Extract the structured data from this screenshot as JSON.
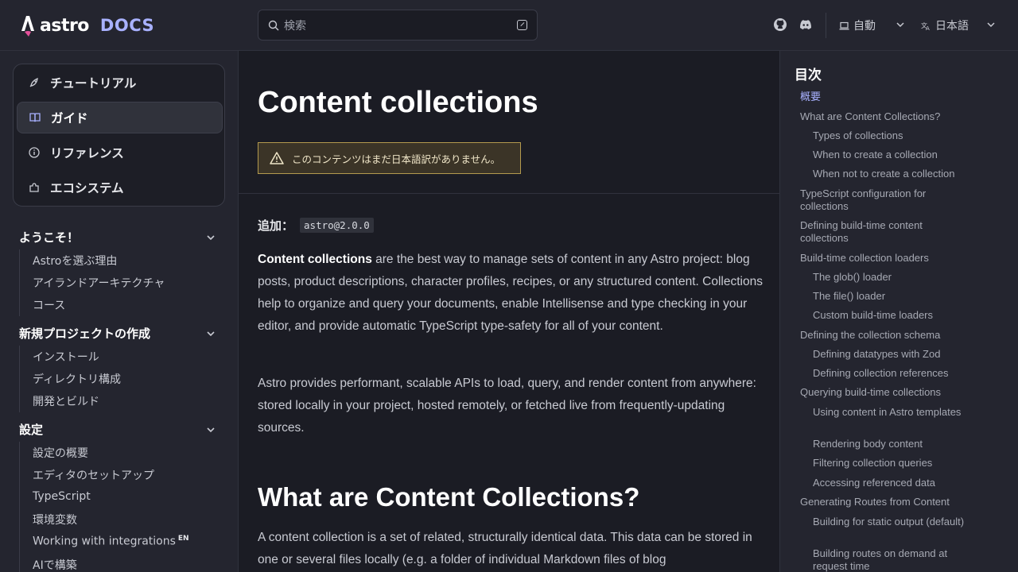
{
  "header": {
    "logo_word": "astro",
    "logo_docs": "DOCS",
    "search_placeholder": "検索",
    "theme_select": "自動",
    "language_select": "日本語"
  },
  "sidebar": {
    "top_nav": [
      {
        "label": "チュートリアル",
        "icon": "rocket-icon"
      },
      {
        "label": "ガイド",
        "icon": "book-icon",
        "active": true
      },
      {
        "label": "リファレンス",
        "icon": "info-icon"
      },
      {
        "label": "エコシステム",
        "icon": "puzzle-icon"
      }
    ],
    "groups": [
      {
        "title": "ようこそ！",
        "items": [
          "Astroを選ぶ理由",
          "アイランドアーキテクチャ",
          "コース"
        ]
      },
      {
        "title": "新規プロジェクトの作成",
        "items": [
          "インストール",
          "ディレクトリ構成",
          "開発とビルド"
        ]
      },
      {
        "title": "設定",
        "items": [
          "設定の概要",
          "エディタのセットアップ",
          "TypeScript",
          "環境変数",
          "Working with integrations",
          "AIで構築"
        ]
      }
    ],
    "en_tag": "EN"
  },
  "main": {
    "title": "Content collections",
    "caution": "このコンテンツはまだ日本語訳がありません。",
    "added_label": "追加：",
    "added_version": "astro@2.0.0",
    "intro_bold": "Content collections",
    "intro_rest": " are the best way to manage sets of content in any Astro project: blog posts, product descriptions, character profiles, recipes, or any structured content. Collections help to organize and query your documents, enable Intellisense and type checking in your editor, and provide automatic TypeScript type-safety for all of your content.",
    "para2": "Astro provides performant, scalable APIs to load, query, and render content from anywhere: stored locally in your project, hosted remotely, or fetched live from frequently-updating sources.",
    "h2": "What are Content Collections?",
    "para3": "A content collection is a set of related, structurally identical data. This data can be stored in one or several files locally (e.g. a folder of individual Markdown files of blog"
  },
  "toc": {
    "title": "目次",
    "items": [
      {
        "label": "概要",
        "level": 1,
        "current": true
      },
      {
        "label": "What are Content Collections?",
        "level": 1
      },
      {
        "label": "Types of collections",
        "level": 2
      },
      {
        "label": "When to create a collection",
        "level": 2
      },
      {
        "label": "When not to create a collection",
        "level": 2
      },
      {
        "label": "TypeScript configuration for collections",
        "level": 1
      },
      {
        "label": "Defining build-time content collections",
        "level": 1
      },
      {
        "label": "Build-time collection loaders",
        "level": 1
      },
      {
        "label": "The glob() loader",
        "level": 2
      },
      {
        "label": "The file() loader",
        "level": 2
      },
      {
        "label": "Custom build-time loaders",
        "level": 2
      },
      {
        "label": "Defining the collection schema",
        "level": 1
      },
      {
        "label": "Defining datatypes with Zod",
        "level": 2
      },
      {
        "label": "Defining collection references",
        "level": 2
      },
      {
        "label": "Querying build-time collections",
        "level": 1
      },
      {
        "label": "Using content in Astro templates",
        "level": 2
      },
      {
        "label": "Rendering body content",
        "level": 2
      },
      {
        "label": "Filtering collection queries",
        "level": 2
      },
      {
        "label": "Accessing referenced data",
        "level": 2
      },
      {
        "label": "Generating Routes from Content",
        "level": 1
      },
      {
        "label": "Building for static output (default)",
        "level": 2
      },
      {
        "label": "Building routes on demand at request time",
        "level": 2
      }
    ]
  },
  "colors": {
    "accent": "#a8b1ff",
    "background": "#24252f",
    "content_bg": "#1b1c24",
    "caution_border": "#b39a4e"
  }
}
